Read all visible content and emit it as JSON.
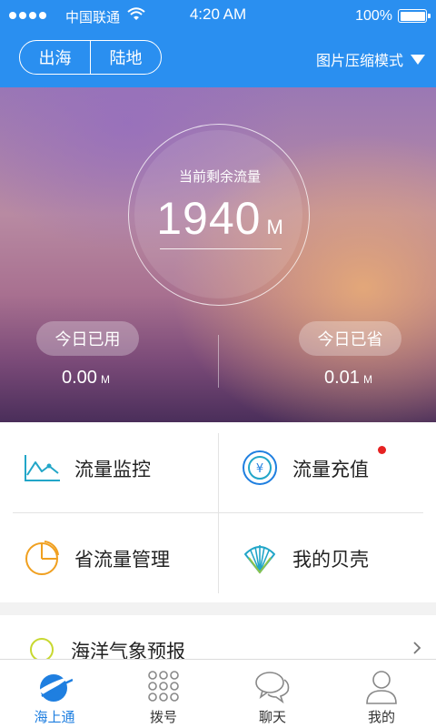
{
  "status_bar": {
    "carrier": "中国联通",
    "time": "4:20 AM",
    "battery": "100%",
    "icons": [
      "signal-dots-icon",
      "wifi-icon",
      "battery-icon"
    ]
  },
  "header": {
    "segments": [
      {
        "label": "出海",
        "selected": true
      },
      {
        "label": "陆地",
        "selected": false
      }
    ],
    "mode_label": "图片压缩模式",
    "mode_icon": "caret-down-icon",
    "background_color": "#2a8ff0"
  },
  "hero": {
    "gauge_label": "当前剩余流量",
    "gauge_value": "1940",
    "gauge_unit": "M",
    "used_label": "今日已用",
    "used_value": "0.00",
    "used_unit": "M",
    "saved_label": "今日已省",
    "saved_value": "0.01",
    "saved_unit": "M"
  },
  "menu": [
    {
      "label": "流量监控",
      "icon": "chart-line-icon"
    },
    {
      "label": "流量充值",
      "icon": "yuan-coin-icon",
      "badge": "red-dot"
    },
    {
      "label": "省流量管理",
      "icon": "pie-chart-icon"
    },
    {
      "label": "我的贝壳",
      "icon": "shell-icon"
    }
  ],
  "weather": {
    "label": "海洋气象预报",
    "icon": "weather-icon",
    "chevron": "chevron-right-icon"
  },
  "tabs": [
    {
      "label": "海上通",
      "icon": "sea-logo-icon",
      "active": true
    },
    {
      "label": "拨号",
      "icon": "dialpad-icon",
      "active": false
    },
    {
      "label": "聊天",
      "icon": "chat-bubbles-icon",
      "active": false
    },
    {
      "label": "我的",
      "icon": "person-icon",
      "active": false
    }
  ],
  "colors": {
    "brand_blue": "#2a8ff0",
    "active_tab": "#1f7fe0",
    "badge_red": "#e62222",
    "chart_icon_teal": "#22a6c8",
    "pie_icon_orange": "#f0a020"
  }
}
